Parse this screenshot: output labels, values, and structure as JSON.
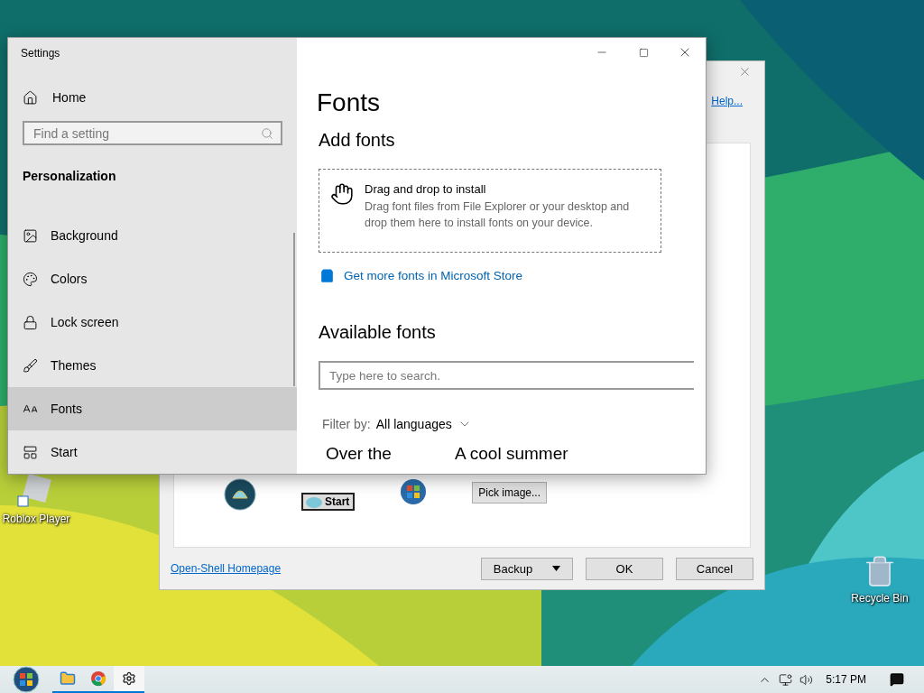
{
  "desktop": {
    "icons": [
      {
        "label": "Roblox Player",
        "kind": "roblox"
      },
      {
        "label": "Recycle Bin",
        "kind": "bin"
      }
    ]
  },
  "back_window": {
    "help_link": "Help...",
    "start_button": "Start",
    "image_button": "Pick image...",
    "homepage_link": "Open-Shell Homepage",
    "buttons": [
      {
        "label": "Backup",
        "kind": "split"
      },
      {
        "label": "OK",
        "kind": "plain"
      },
      {
        "label": "Cancel",
        "kind": "plain"
      }
    ]
  },
  "settings": {
    "title": "Settings",
    "home": "Home",
    "search_placeholder": "Find a setting",
    "section": "Personalization",
    "nav": [
      {
        "label": "Background",
        "selected": false
      },
      {
        "label": "Colors",
        "kind": "palette",
        "selected": false
      },
      {
        "label": "Lock screen",
        "kind": "lock",
        "selected": false
      },
      {
        "label": "Themes",
        "kind": "brush",
        "selected": false
      },
      {
        "label": "Fonts",
        "kind": "fonts",
        "selected": true
      },
      {
        "label": "Start",
        "kind": "start",
        "selected": false
      }
    ],
    "page_title": "Fonts",
    "add_heading": "Add fonts",
    "drop_title": "Drag and drop to install",
    "drop_text": "Drag font files from File Explorer or your desktop and drop them here to install fonts on your device.",
    "store_link": "Get more fonts in Microsoft Store",
    "available_heading": "Available fonts",
    "font_search_placeholder": "Type here to search.",
    "filter_label": "Filter by:",
    "filter_value": "All languages",
    "previews": [
      "Over the",
      "A cool summer"
    ]
  },
  "taskbar": {
    "apps": [
      {
        "kind": "folder",
        "selected": false
      },
      {
        "kind": "browser",
        "selected": false
      },
      {
        "kind": "gear",
        "selected": true
      }
    ],
    "clock": "5:17 PM"
  }
}
